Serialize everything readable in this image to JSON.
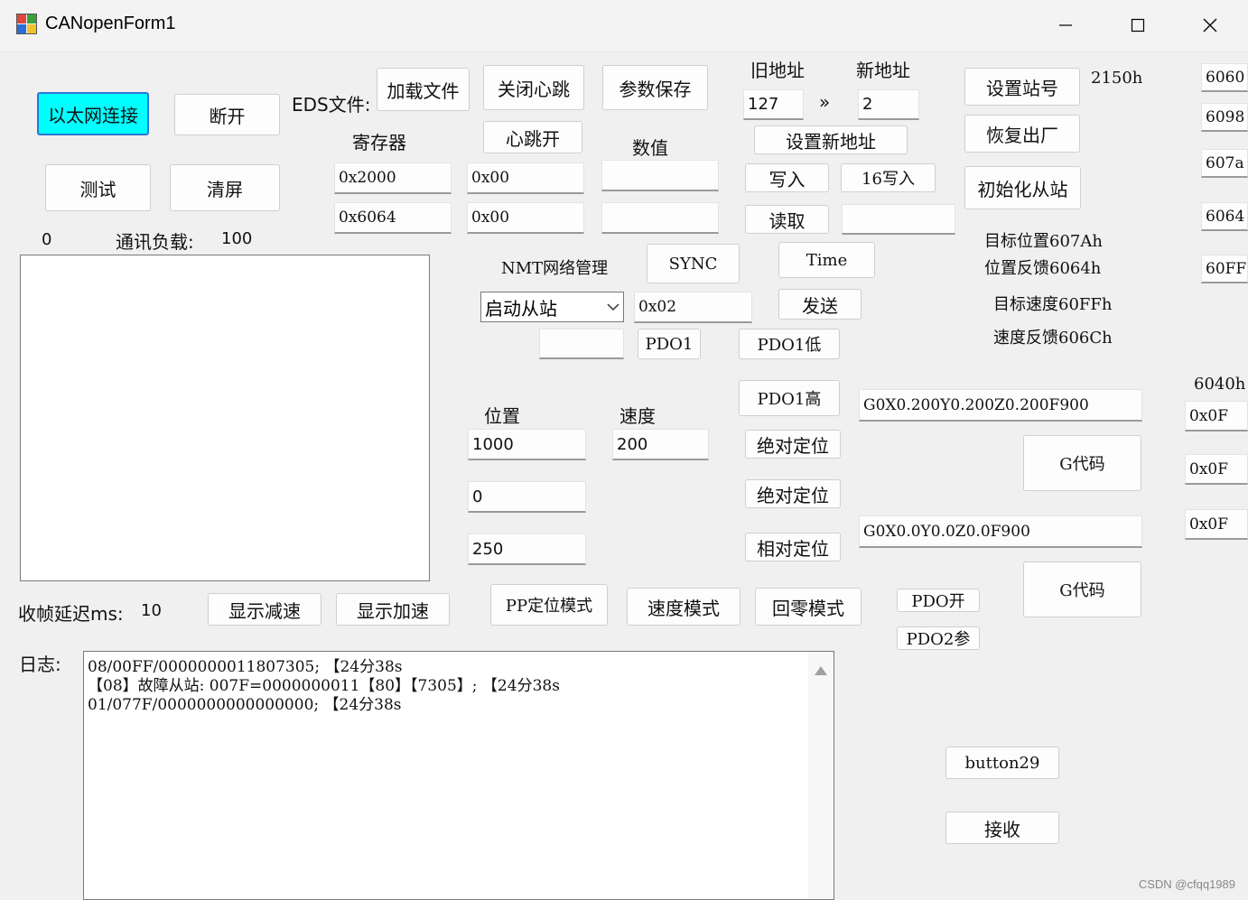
{
  "window": {
    "title": "CANopenForm1"
  },
  "buttons": {
    "ethernet_connect": "以太网连接",
    "disconnect": "断开",
    "load_file": "加载文件",
    "close_heartbeat": "关闭心跳",
    "save_params": "参数保存",
    "heartbeat_on": "心跳开",
    "test": "测试",
    "clear_screen": "清屏",
    "set_station": "设置站号",
    "factory_reset": "恢复出厂",
    "init_slave": "初始化从站",
    "set_new_address": "设置新地址",
    "write": "写入",
    "write16": "16写入",
    "read": "读取",
    "sync": "SYNC",
    "time": "Time",
    "send": "发送",
    "pdo1": "PDO1",
    "pdo1_low": "PDO1低",
    "pdo1_high": "PDO1高",
    "abs_pos1": "绝对定位",
    "abs_pos2": "绝对定位",
    "rel_pos": "相对定位",
    "gcode1": "G代码",
    "gcode2": "G代码",
    "show_decel": "显示减速",
    "show_accel": "显示加速",
    "pp_mode": "PP定位模式",
    "velocity_mode": "速度模式",
    "homing_mode": "回零模式",
    "pdo_on": "PDO开",
    "pdo2_param": "PDO2参",
    "button29": "button29",
    "receive": "接收"
  },
  "labels": {
    "eds_file": "EDS文件:",
    "register": "寄存器",
    "value": "数值",
    "old_address": "旧地址",
    "new_address": "新地址",
    "arrow": "»",
    "addr_2150h": "2150h",
    "zero": "0",
    "comm_load": "通讯负载:",
    "comm_load_value": "100",
    "nmt": "NMT网络管理",
    "target_position": "目标位置607Ah",
    "position_feedback": "位置反馈6064h",
    "target_velocity": "目标速度60FFh",
    "velocity_feedback": "速度反馈606Ch",
    "position": "位置",
    "speed": "速度",
    "label_6040h": "6040h",
    "frame_delay": "收帧延迟ms:",
    "frame_delay_value": "10",
    "log": "日志:"
  },
  "fields": {
    "old_address": "127",
    "new_address": "2",
    "reg1_index": "0x2000",
    "reg1_sub": "0x00",
    "reg1_value": "",
    "reg2_index": "0x6064",
    "reg2_sub": "0x00",
    "reg2_value": "",
    "read_value": "",
    "nmt_code": "0x02",
    "nmt_extra": "",
    "position": "1000",
    "speed": "200",
    "pos2": "0",
    "pos3": "250",
    "gcode1": "G0X0.200Y0.200Z0.200F900",
    "gcode2": "G0X0.0Y0.0Z0.0F900",
    "ctl1": "0x0F",
    "ctl2": "0x0F",
    "ctl3": "0x0F"
  },
  "nmt_select": {
    "selected": "启动从站"
  },
  "right_column": [
    "6060",
    "6098",
    "607a",
    "6064",
    "60FF"
  ],
  "log_lines": [
    "08/00FF/0000000011807305; 【24分38s",
    "【08】故障从站: 007F=0000000011【80】【7305】; 【24分38s",
    "01/077F/0000000000000000; 【24分38s"
  ],
  "watermark": "CSDN @cfqq1989"
}
